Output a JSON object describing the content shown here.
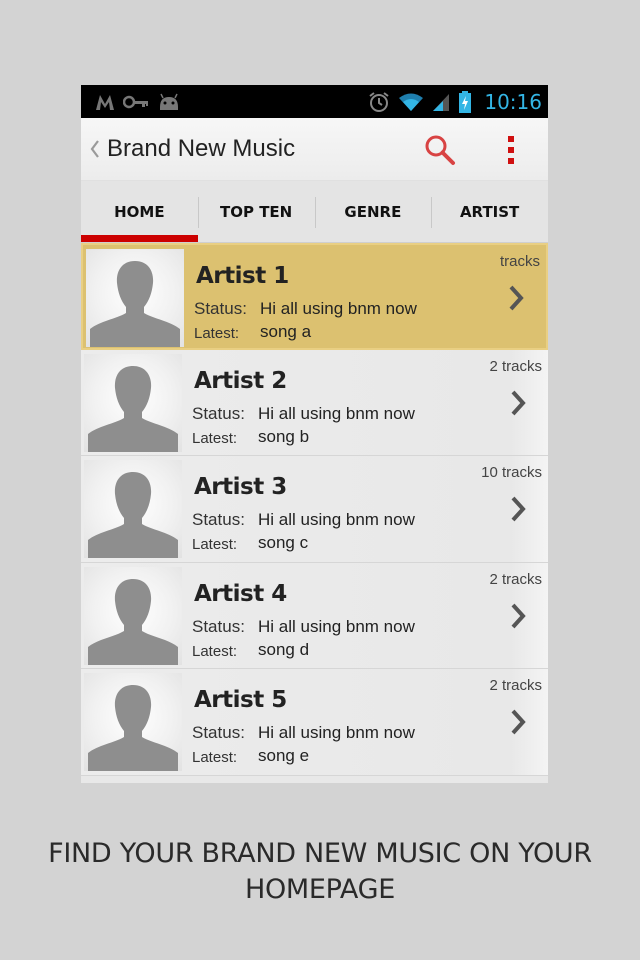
{
  "status_bar": {
    "time": "10:16",
    "icons": [
      "m-logo-icon",
      "key-icon",
      "android-icon",
      "alarm-icon",
      "wifi-icon",
      "signal-icon",
      "battery-charging-icon"
    ],
    "time_color": "#33b5e5"
  },
  "action_bar": {
    "title": "Brand New Music",
    "icons": [
      "back-chevron-icon",
      "search-icon",
      "overflow-menu-icon"
    ],
    "accent_color": "#cc0000"
  },
  "tabs": [
    {
      "label": "HOME",
      "active": true
    },
    {
      "label": "TOP TEN",
      "active": false
    },
    {
      "label": "GENRE",
      "active": false
    },
    {
      "label": "ARTIST",
      "active": false
    }
  ],
  "artists": [
    {
      "name": "Artist 1",
      "status_label": "Status:",
      "status": "Hi all using bnm now",
      "latest_label": "Latest:",
      "latest": "song a",
      "tracks": "tracks",
      "highlighted": true
    },
    {
      "name": "Artist 2",
      "status_label": "Status:",
      "status": "Hi all using bnm now",
      "latest_label": "Latest:",
      "latest": "song b",
      "tracks": "2 tracks",
      "highlighted": false
    },
    {
      "name": "Artist 3",
      "status_label": "Status:",
      "status": "Hi all using bnm now",
      "latest_label": "Latest:",
      "latest": "song c",
      "tracks": "10 tracks",
      "highlighted": false
    },
    {
      "name": "Artist 4",
      "status_label": "Status:",
      "status": "Hi all using bnm now",
      "latest_label": "Latest:",
      "latest": "song d",
      "tracks": "2 tracks",
      "highlighted": false
    },
    {
      "name": "Artist 5",
      "status_label": "Status:",
      "status": "Hi all using bnm now",
      "latest_label": "Latest:",
      "latest": "song e",
      "tracks": "2 tracks",
      "highlighted": false
    }
  ],
  "highlight_color": "#dcc170",
  "caption": {
    "line1": "FIND YOUR BRAND NEW MUSIC ON YOUR",
    "line2": "HOMEPAGE"
  }
}
